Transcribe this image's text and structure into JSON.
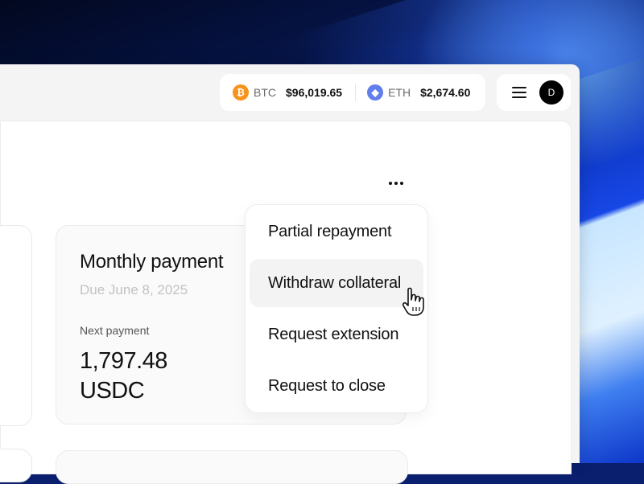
{
  "ticker": {
    "btc": {
      "symbol": "BTC",
      "price": "$96,019.65",
      "icon": "bitcoin-icon",
      "glyph": "₿",
      "color": "#f7931a"
    },
    "eth": {
      "symbol": "ETH",
      "price": "$2,674.60",
      "icon": "ethereum-icon",
      "glyph": "◆",
      "color": "#627eea"
    }
  },
  "header": {
    "menu_icon": "hamburger-menu-icon",
    "avatar_initial": "D"
  },
  "card": {
    "title": "Monthly payment",
    "due": "Due June 8, 2025",
    "next_label": "Next payment",
    "amount": "1,797.48",
    "currency": "USDC"
  },
  "more_button_icon": "more-horizontal-icon",
  "dropdown": {
    "items": [
      {
        "label": "Partial repayment"
      },
      {
        "label": "Withdraw collateral",
        "hovered": true
      },
      {
        "label": "Request extension"
      },
      {
        "label": "Request to close"
      }
    ]
  },
  "cursor_icon": "pointer-hand-icon"
}
